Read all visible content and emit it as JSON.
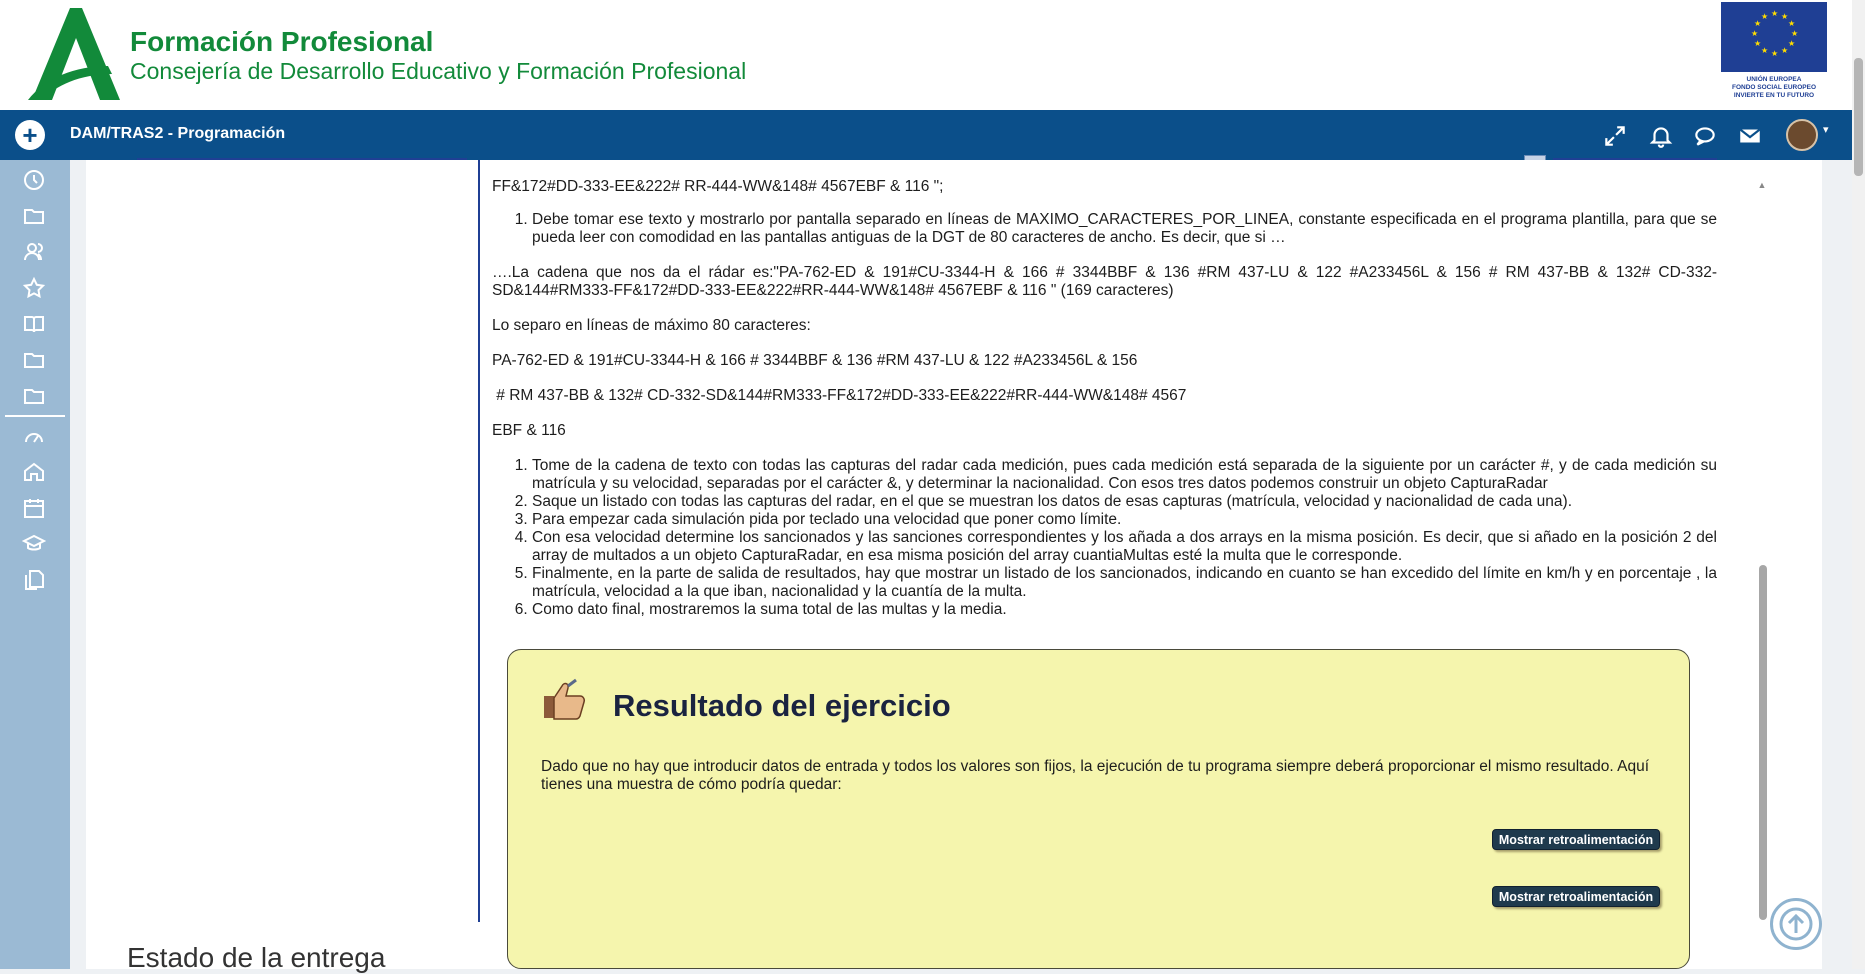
{
  "header": {
    "title": "Formación Profesional",
    "subtitle": "Consejería de Desarrollo Educativo y Formación Profesional",
    "eu_text": [
      "UNIÓN EUROPEA",
      "FONDO SOCIAL EUROPEO",
      "INVIERTE EN TU FUTURO"
    ]
  },
  "navbar": {
    "add_label": "+",
    "course_title": "DAM/TRAS2 - Programación",
    "icons": [
      "fullscreen-icon",
      "bell-icon",
      "chat-icon",
      "mail-icon",
      "avatar",
      "caret-down-icon"
    ]
  },
  "sidebar": {
    "icons": [
      "clock-icon",
      "folder-icon",
      "users-icon",
      "star-icon",
      "book-icon",
      "folder-icon",
      "folder-icon",
      "dashboard-icon",
      "home-icon",
      "calendar-icon",
      "graduation-cap-icon",
      "files-icon"
    ]
  },
  "content": {
    "line0": "FF&172#DD-333-EE&222# RR-444-WW&148# 4567EBF & 116 \";",
    "list1": [
      "Debe tomar ese texto  y mostrarlo por pantalla separado en líneas de MAXIMO_CARACTERES_POR_LINEA, constante especificada en el programa plantilla,  para que se pueda leer con comodidad en las pantallas antiguas de la DGT de 80 caracteres de ancho. Es decir, que si …"
    ],
    "p_radar": "….La cadena que nos da el rádar es:\"PA-762-ED & 191#CU-3344-H & 166 # 3344BBF & 136 #RM 437-LU & 122 #A233456L & 156 # RM 437-BB & 132# CD-332-SD&144#RM333-FF&172#DD-333-EE&222#RR-444-WW&148# 4567EBF & 116 \" (169 caracteres)",
    "p_split": "Lo separo en líneas de máximo 80 caracteres:",
    "p_l1": "PA-762-ED & 191#CU-3344-H & 166 # 3344BBF & 136 #RM 437-LU & 122 #A233456L & 156",
    "p_l2": " # RM 437-BB & 132# CD-332-SD&144#RM333-FF&172#DD-333-EE&222#RR-444-WW&148# 4567",
    "p_l3": "EBF & 116",
    "list2": [
      "Tome de la cadena de texto con todas las capturas del radar cada medición, pues cada medición está separada de la siguiente por un carácter #, y de cada medición su matrícula y su velocidad, separadas por el carácter &,  y determinar la nacionalidad. Con esos tres datos podemos construir un objeto CapturaRadar",
      "Saque un listado con todas las capturas del radar, en el que se muestran los datos de esas capturas (matrícula, velocidad y nacionalidad de cada una).",
      "Para empezar cada simulación pida por teclado una velocidad que poner como límite.",
      "Con esa velocidad determine  los sancionados y las sanciones correspondientes y los añada a dos arrays en la misma posición. Es decir, que si añado en la posición 2 del array de multados a un objeto CapturaRadar, en esa misma posición del array cuantiaMultas esté la multa que le corresponde.",
      "Finalmente, en la parte de salida de resultados, hay que mostrar un listado de los sancionados,  indicando en cuanto se han excedido del límite en km/h y en porcentaje , la matrícula, velocidad a la que iban, nacionalidad y la cuantía de la multa.",
      "Como dato final, mostraremos la suma total de las multas y la media."
    ]
  },
  "result": {
    "title": "Resultado del ejercicio",
    "text": "Dado que no hay que introducir datos de entrada y todos los valores son fijos, la ejecución de tu programa siempre deberá proporcionar el mismo resultado. Aquí tienes una muestra de cómo podría quedar:",
    "button1": "Mostrar retroalimentación",
    "button2": "Mostrar retroalimentación"
  },
  "bottom": {
    "heading": "Estado de la entrega"
  }
}
